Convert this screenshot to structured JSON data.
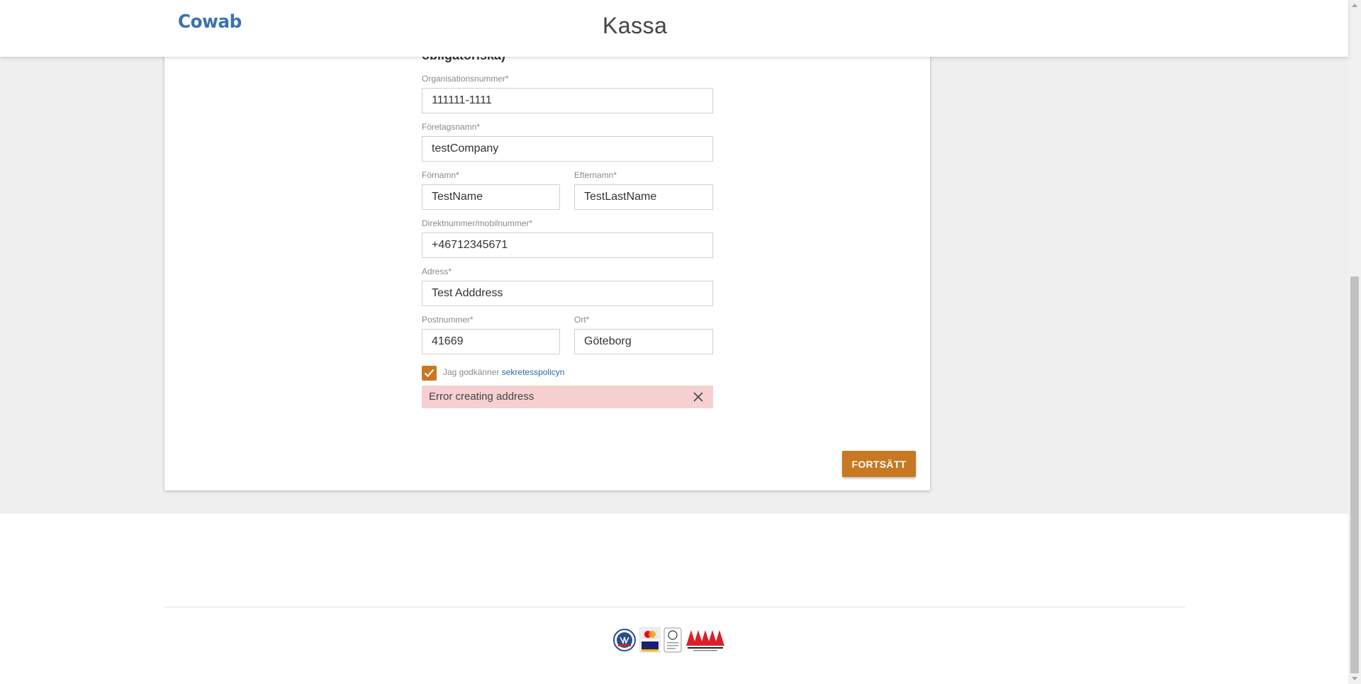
{
  "header": {
    "logo": "Cowab",
    "title": "Kassa"
  },
  "form": {
    "section_heading": "obligatoriska)",
    "org_number": {
      "label": "Organisationsnummer*",
      "value": "111111-1111"
    },
    "company_name": {
      "label": "Företagsnamn*",
      "value": "testCompany"
    },
    "first_name": {
      "label": "Förnamn*",
      "value": "TestName"
    },
    "last_name": {
      "label": "Efternamn*",
      "value": "TestLastName"
    },
    "phone": {
      "label": "Direktnummer/mobilnummer*",
      "value": "+46712345671"
    },
    "address": {
      "label": "Adress*",
      "value": "Test Adddress"
    },
    "postal_code": {
      "label": "Postnummer*",
      "value": "41669"
    },
    "city": {
      "label": "Ort*",
      "value": "Göteborg"
    },
    "consent": {
      "checked": true,
      "text": "Jag godkänner ",
      "link": "sekretesspolicyn"
    },
    "error": "Error creating address",
    "continue_button": "FORTSÄTT"
  },
  "footer": {
    "badges": [
      "va-badge",
      "mastercard-visa-badge",
      "sp-certified-badge",
      "aaa-credit-badge"
    ],
    "aaa_text": "AAA"
  },
  "colors": {
    "accent": "#c87822",
    "logo": "#3a72b0",
    "error_bg": "#f6d0d0",
    "link": "#2b6aa8"
  }
}
